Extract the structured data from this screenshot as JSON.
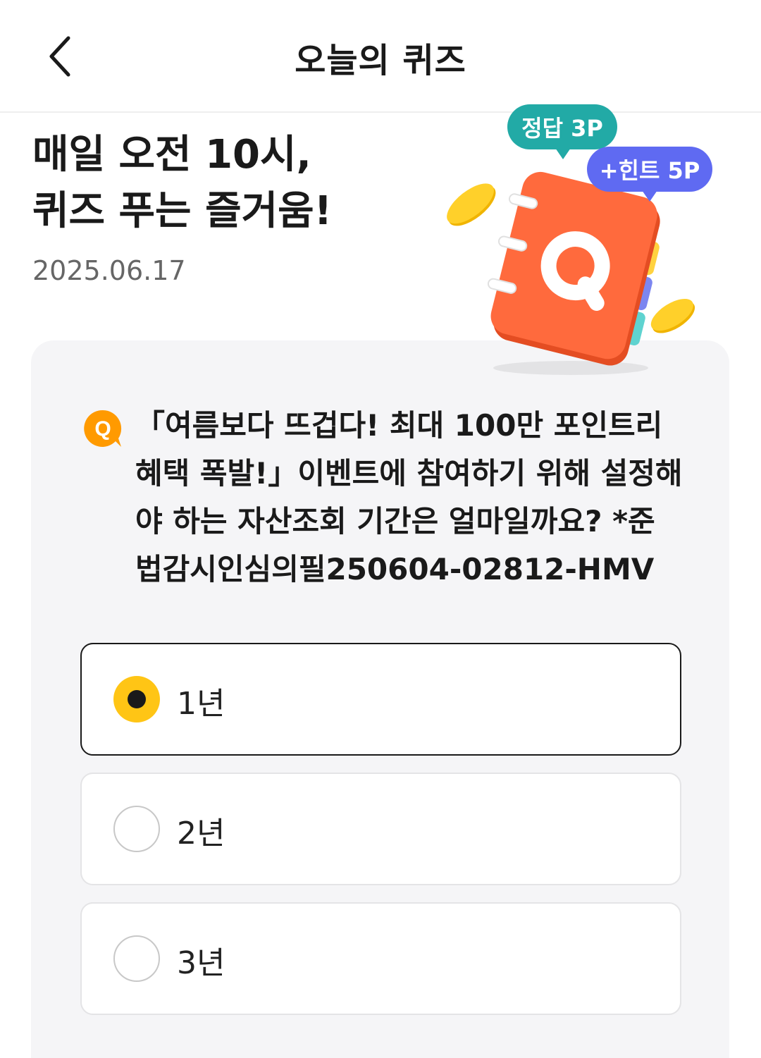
{
  "header": {
    "title": "오늘의 퀴즈",
    "back_icon": "chevron-left-icon"
  },
  "hero": {
    "title_line1": "매일 오전 10시,",
    "title_line2": "퀴즈 푸는 즐거움!",
    "date": "2025.06.17"
  },
  "illustration": {
    "answer_badge": "정답 3P",
    "hint_badge": "+힌트 5P",
    "book_letter": "Q",
    "colors": {
      "answer_badge": "#22aaa6",
      "hint_badge": "#5f6af2",
      "book": "#ff6a3d",
      "coin": "#ffc515"
    }
  },
  "quiz": {
    "q_icon_label": "Q",
    "question_lines": [
      "「여름보다 뜨겁다! 최대 100만 포인트리",
      "혜택 폭발!」이벤트에 참여하기 위해 설정해",
      "야 하는 자산조회 기간은 얼마일까요? *준",
      "법감시인심의필250604-02812-HMV"
    ],
    "options": [
      {
        "label": "1년",
        "selected": true
      },
      {
        "label": "2년",
        "selected": false
      },
      {
        "label": "3년",
        "selected": false
      }
    ]
  }
}
